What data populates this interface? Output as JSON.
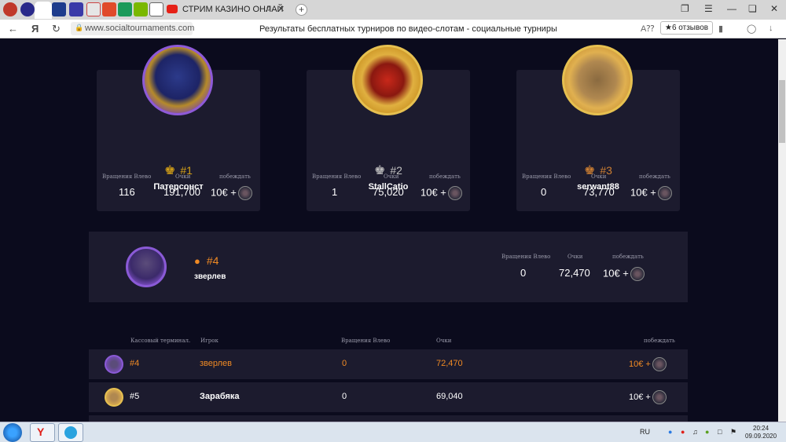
{
  "browser": {
    "tab_title": "СТРИМ КАЗИНО ОНЛАЙ",
    "url": "www.socialtournaments.com",
    "page_title": "Результаты бесплатных турниров по видео-слотам - социальные турниры",
    "reviews": "★6 отзывов"
  },
  "podium": [
    {
      "rank": "#1",
      "name": "Патерсонст",
      "spins": "116",
      "points": "191,700",
      "prize": "10€ +",
      "crown_color": "#d4a017"
    },
    {
      "rank": "#2",
      "name": "StallCatio",
      "spins": "1",
      "points": "75,020",
      "prize": "10€ +",
      "crown_color": "#c0c0c0"
    },
    {
      "rank": "#3",
      "name": "serwant88",
      "spins": "0",
      "points": "73,770",
      "prize": "10€ +",
      "crown_color": "#cd7f32"
    }
  ],
  "labels": {
    "spins": "Вращения Влево",
    "points": "Очки",
    "wins": "побеждать",
    "terminal": "Кассовый терминал.",
    "player": "Игрок"
  },
  "you": {
    "rank": "#4",
    "name": "зверлев",
    "spins": "0",
    "points": "72,470",
    "prize": "10€ +"
  },
  "rows": [
    {
      "rank": "#4",
      "name": "зверлев",
      "spins": "0",
      "points": "72,470",
      "prize": "10€ +",
      "highlight": true
    },
    {
      "rank": "#5",
      "name": "Зарабяка",
      "spins": "0",
      "points": "69,040",
      "prize": "10€ +",
      "highlight": false
    }
  ],
  "colors": {
    "accent_orange": "#f08a24",
    "gold": "#d4a017",
    "silver": "#c0c0c0",
    "bronze": "#cd7f32",
    "card_bg": "#1c1b2e",
    "page_bg": "#0b0b1d"
  },
  "taskbar": {
    "lang": "RU",
    "time": "20:24",
    "date": "09.09.2020"
  }
}
